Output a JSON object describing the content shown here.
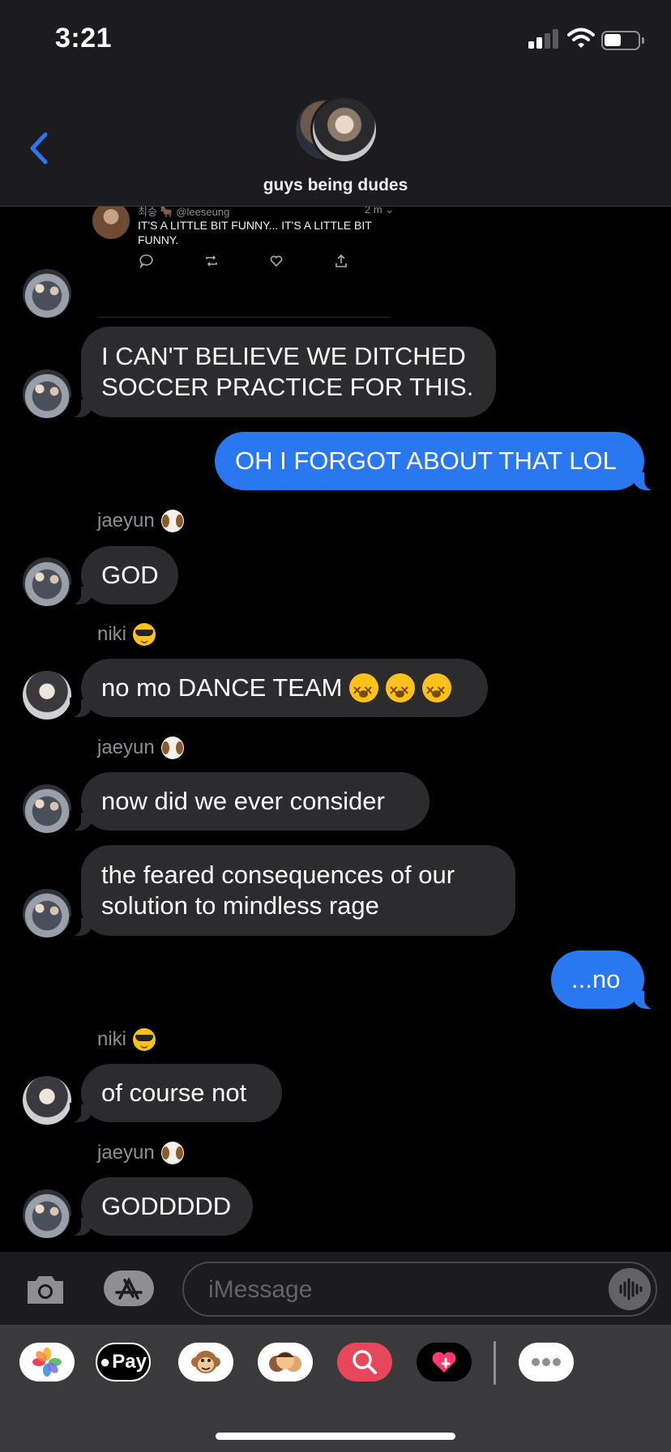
{
  "status_bar": {
    "time": "3:21"
  },
  "header": {
    "group_name": "guys being dudes"
  },
  "tweet": {
    "handle": "최승 🐂 @leeseung",
    "time": "2 m ⌄",
    "text": "IT'S A LITTLE BIT FUNNY... IT'S A LITTLE BIT FUNNY."
  },
  "messages": [
    {
      "id": "m1",
      "text": "I CAN'T BELIEVE WE DITCHED\nSOCCER PRACTICE FOR THIS."
    },
    {
      "id": "m2",
      "text": "OH I FORGOT ABOUT THAT LOL"
    },
    {
      "id": "s1",
      "sender": "jaeyun"
    },
    {
      "id": "m3",
      "text": "GOD"
    },
    {
      "id": "s2",
      "sender": "niki"
    },
    {
      "id": "m4",
      "text": "no mo DANCE TEAM"
    },
    {
      "id": "s3",
      "sender": "jaeyun"
    },
    {
      "id": "m5",
      "text": "now did we ever consider"
    },
    {
      "id": "m6",
      "text": "the feared consequences of our\nsolution to mindless rage"
    },
    {
      "id": "m7",
      "text": "...no"
    },
    {
      "id": "s4",
      "sender": "niki"
    },
    {
      "id": "m8",
      "text": "of course not"
    },
    {
      "id": "s5",
      "sender": "jaeyun"
    },
    {
      "id": "m9",
      "text": "GODDDDD"
    }
  ],
  "input": {
    "placeholder": "iMessage"
  },
  "drawer": {
    "pay_label": "Pay"
  },
  "colors": {
    "outgoing": "#2a78f0",
    "incoming": "#2c2c2e",
    "header": "#1c1c1e"
  },
  "icons": [
    "chevron-left-icon",
    "camera-icon",
    "app-store-icon",
    "audio-wave-icon",
    "photos-icon",
    "apple-pay-icon",
    "monkey-icon",
    "memoji-icon",
    "search-images-icon",
    "digital-touch-icon",
    "more-icon"
  ]
}
